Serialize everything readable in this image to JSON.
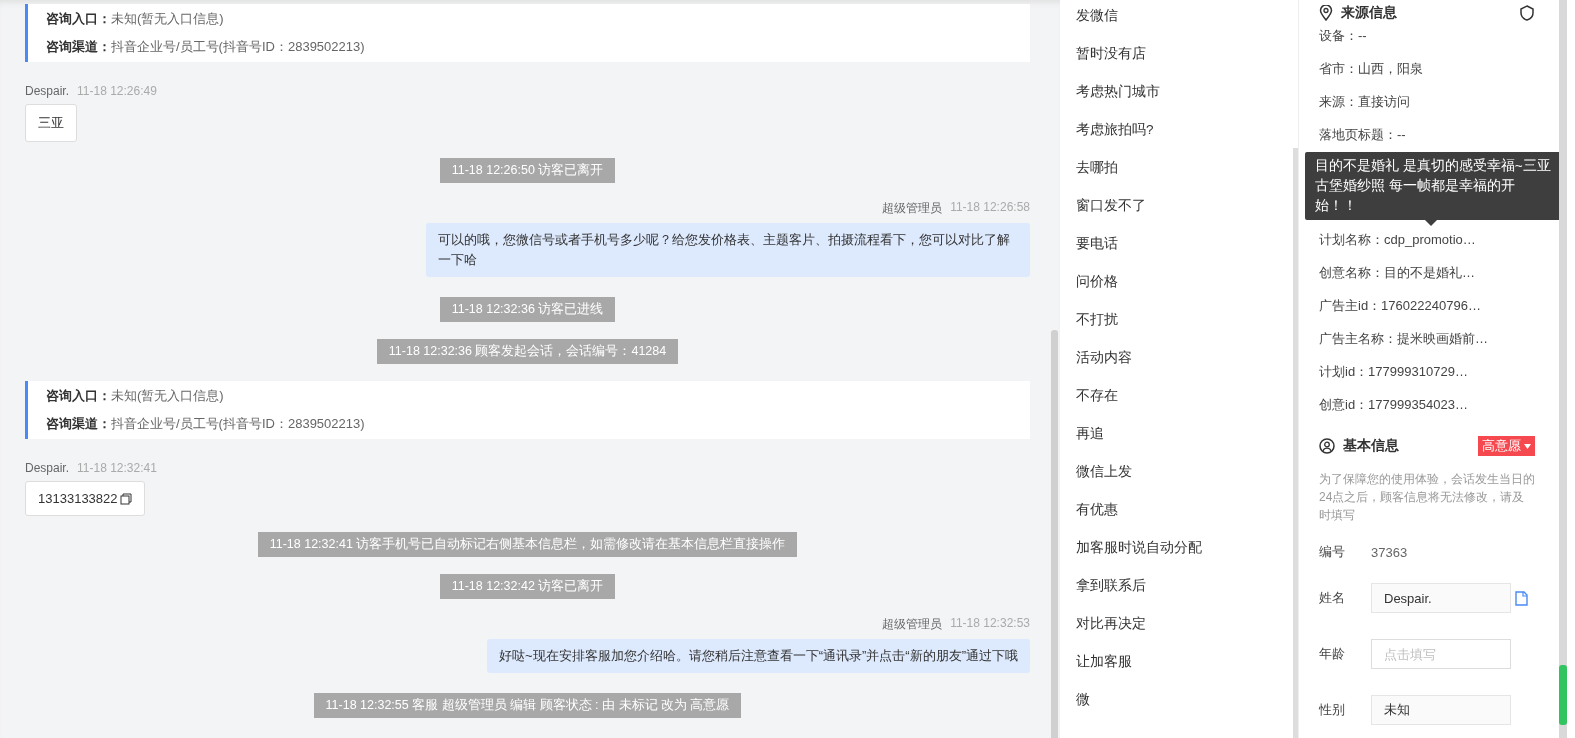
{
  "chat": [
    {
      "kind": "info_card",
      "rows": [
        {
          "label": "咨询入口：",
          "value": "未知(暂无入口信息)"
        },
        {
          "label": "咨询渠道：",
          "value": "抖音企业号/员工号(抖音号ID：2839502213)"
        }
      ]
    },
    {
      "kind": "visitor_sender",
      "name": "Despair.",
      "time": "11-18 12:26:49"
    },
    {
      "kind": "visitor_bubble",
      "text": "三亚",
      "copyable": false
    },
    {
      "kind": "system",
      "text": "11-18 12:26:50 访客已离开"
    },
    {
      "kind": "agent_sender",
      "name": "超级管理员",
      "time": "11-18 12:26:58"
    },
    {
      "kind": "agent_bubble",
      "text": "可以的哦，您微信号或者手机号多少呢？给您发价格表、主题客片、拍摄流程看下，您可以对比了解一下哈"
    },
    {
      "kind": "system",
      "text": "11-18 12:32:36 访客已进线"
    },
    {
      "kind": "system",
      "text": "11-18 12:32:36 顾客发起会话，会话编号：41284"
    },
    {
      "kind": "info_card",
      "rows": [
        {
          "label": "咨询入口：",
          "value": "未知(暂无入口信息)"
        },
        {
          "label": "咨询渠道：",
          "value": "抖音企业号/员工号(抖音号ID：2839502213)"
        }
      ]
    },
    {
      "kind": "visitor_sender",
      "name": "Despair.",
      "time": "11-18 12:32:41"
    },
    {
      "kind": "visitor_bubble",
      "text": "13133133822",
      "copyable": true
    },
    {
      "kind": "system",
      "text": "11-18 12:32:41 访客手机号已自动标记右侧基本信息栏，如需修改请在基本信息栏直接操作"
    },
    {
      "kind": "system",
      "text": "11-18 12:32:42 访客已离开"
    },
    {
      "kind": "agent_sender",
      "name": "超级管理员",
      "time": "11-18 12:32:53"
    },
    {
      "kind": "agent_bubble",
      "text": "好哒~现在安排客服加您介绍哈。请您稍后注意查看一下“通讯录”并点击“新的朋友”通过下哦"
    },
    {
      "kind": "system",
      "text": "11-18 12:32:55 客服 超级管理员 编辑 顾客状态 : 由 未标记 改为 高意愿"
    }
  ],
  "quick_replies": [
    "发微信",
    "暂时没有店",
    "考虑热门城市",
    "考虑旅拍吗?",
    "去哪拍",
    "窗口发不了",
    "要电话",
    "问价格",
    "不打扰",
    "活动内容",
    "不存在",
    "再追",
    "微信上发",
    "有优惠",
    "加客服时说自动分配",
    "拿到联系后",
    "对比再决定",
    "让加客服",
    "微"
  ],
  "source_info": {
    "title": "来源信息",
    "rows_before_tooltip": [
      "设备：--",
      "省市：山西，阳泉",
      "来源：直接访问",
      "落地页标题：--"
    ],
    "tooltip": "目的不是婚礼 是真切的感受幸福~三亚古堡婚纱照 每一帧都是幸福的开始！！",
    "rows_after_tooltip": [
      "计划名称：cdp_promotio…",
      "创意名称：目的不是婚礼…",
      "广告主id：176022240796…",
      "广告主名称：提米映画婚前…",
      "计划id：177999310729…",
      "创意id：177999354023…"
    ]
  },
  "basic_info": {
    "title": "基本信息",
    "intent_badge": "高意愿",
    "notice": "为了保障您的使用体验，会话发生当日的24点之后，顾客信息将无法修改，请及时填写",
    "fields": [
      {
        "kind": "text",
        "label": "编号",
        "value": "37363"
      },
      {
        "kind": "input",
        "label": "姓名",
        "value": "Despair.",
        "copy": true
      },
      {
        "kind": "input",
        "label": "年龄",
        "placeholder": "点击填写",
        "copy": false
      },
      {
        "kind": "input",
        "label": "性别",
        "value": "未知",
        "copy": false
      }
    ]
  }
}
